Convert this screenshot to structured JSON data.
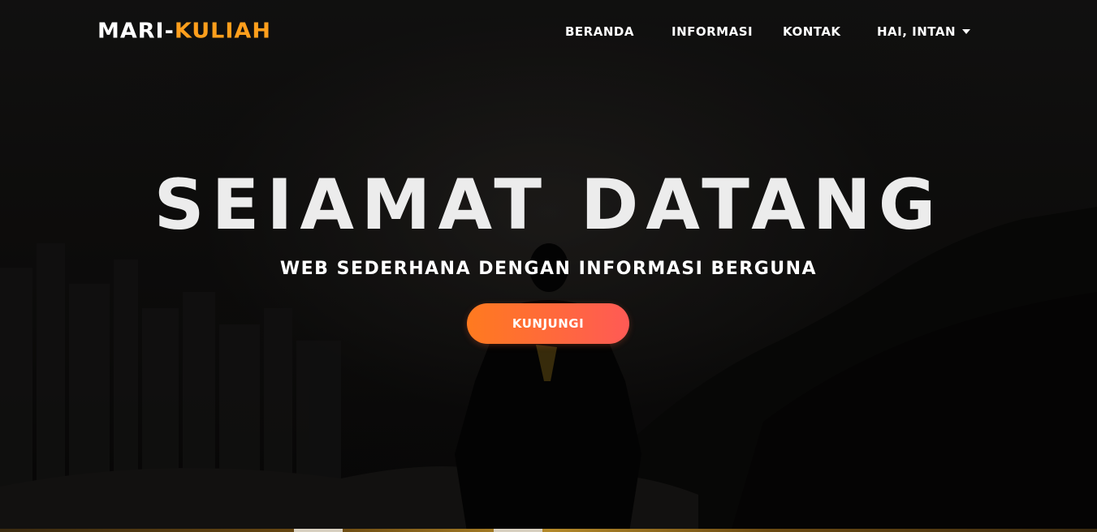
{
  "brand": {
    "part1": "MARI-",
    "part2": "KULIAH",
    "accent_color": "#ff9f1c"
  },
  "nav": {
    "items": [
      {
        "label": "BERANDA"
      },
      {
        "label": "INFORMASI"
      },
      {
        "label": "KONTAK"
      }
    ],
    "user_menu": {
      "label": "HAI, INTAN",
      "icon": "caret-down-icon"
    }
  },
  "hero": {
    "title": "SEIAMAT DATANG",
    "subtitle": "WEB SEDERHANA DENGAN INFORMASI BERGUNA",
    "cta_label": "KUNJUNGI",
    "cta_colors": [
      "#ff7a1f",
      "#ff5a55"
    ]
  }
}
